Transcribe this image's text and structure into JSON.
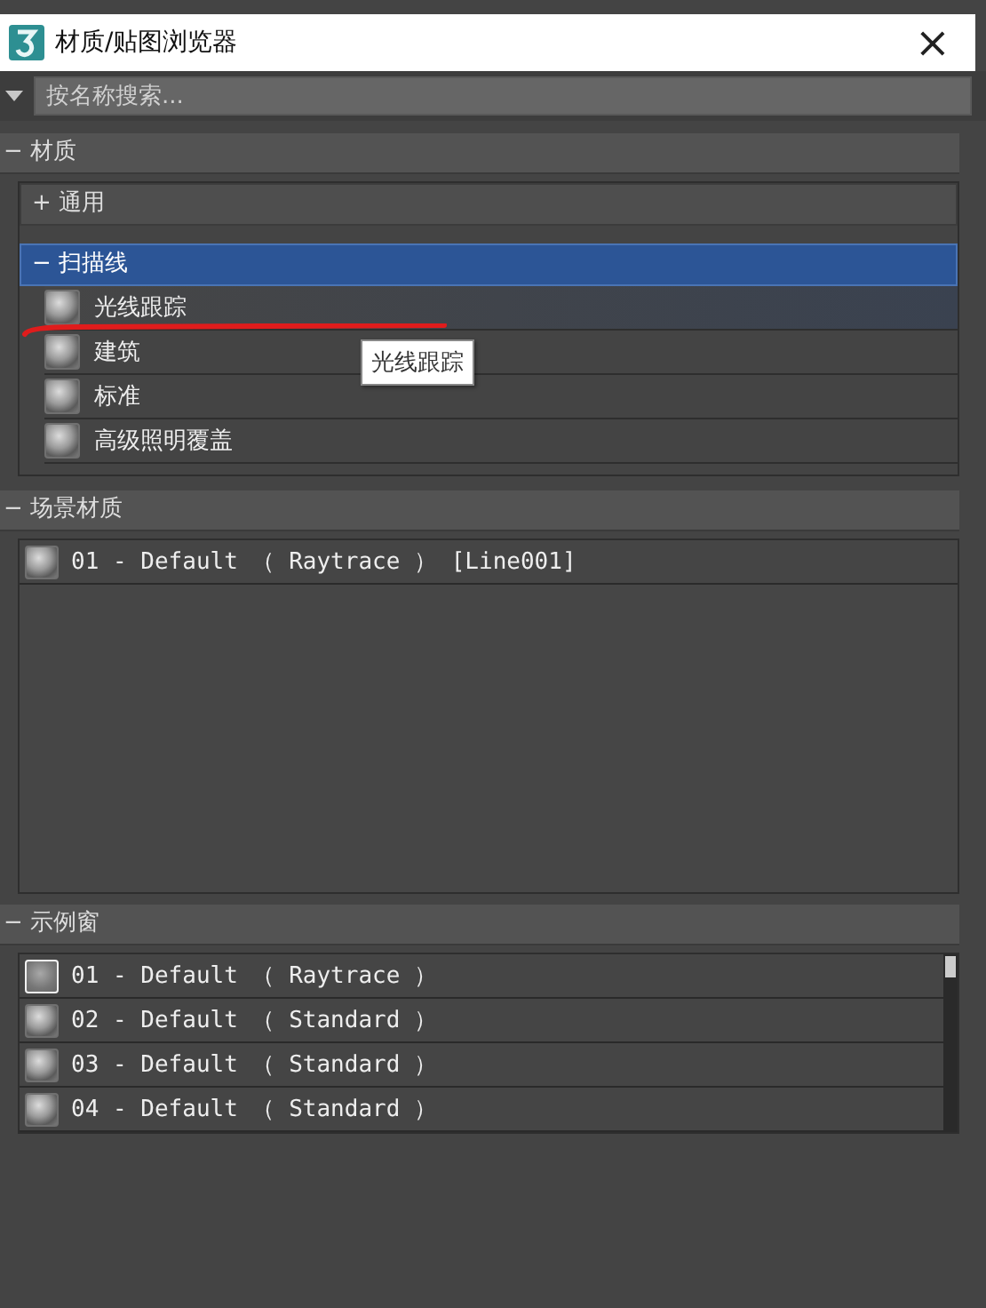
{
  "window": {
    "title": "材质/贴图浏览器",
    "close": "×"
  },
  "search": {
    "placeholder": "按名称搜索..."
  },
  "sections": [
    {
      "title": "− 材质",
      "groups": [
        {
          "title": "+ 通用",
          "expanded": false,
          "selected": false
        },
        {
          "title": "− 扫描线",
          "expanded": true,
          "selected": true,
          "items": [
            {
              "label": "光线跟踪",
              "hovered": true,
              "underlined": true
            },
            {
              "label": "建筑",
              "hovered": false,
              "underlined": false
            },
            {
              "label": "标准",
              "hovered": false,
              "underlined": false
            },
            {
              "label": "高级照明覆盖",
              "hovered": false,
              "underlined": false
            }
          ]
        }
      ]
    },
    {
      "title": "− 场景材质",
      "list": [
        {
          "label": "01 - Default （ Raytrace ） [Line001]",
          "active": false
        }
      ]
    },
    {
      "title": "− 示例窗",
      "list": [
        {
          "label": "01 - Default （ Raytrace ）",
          "active": true
        },
        {
          "label": "02 - Default （ Standard ）",
          "active": false
        },
        {
          "label": "03 - Default （ Standard ）",
          "active": false
        },
        {
          "label": "04 - Default （ Standard ）",
          "active": false
        }
      ]
    }
  ],
  "tooltip": "光线跟踪"
}
